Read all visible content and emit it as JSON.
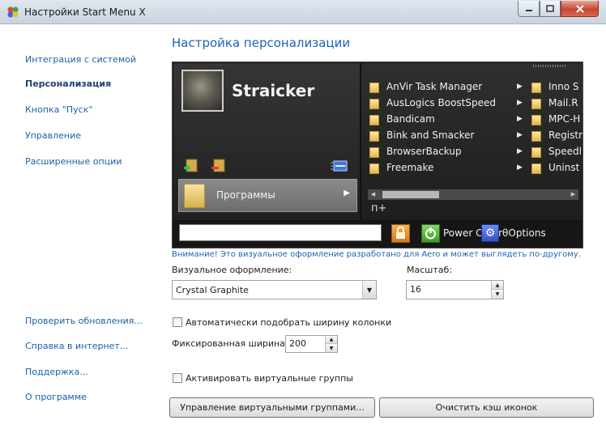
{
  "window": {
    "title": "Настройки Start Menu X"
  },
  "nav": {
    "items": [
      {
        "label": "Интеграция с системой",
        "active": false
      },
      {
        "label": "Персонализация",
        "active": true
      },
      {
        "label": "Кнопка \"Пуск\"",
        "active": false
      },
      {
        "label": "Управление",
        "active": false
      },
      {
        "label": "Расширенные опции",
        "active": false
      }
    ],
    "bottom_items": [
      {
        "label": "Проверить обновления..."
      },
      {
        "label": "Справка в интернет..."
      },
      {
        "label": "Поддержка..."
      },
      {
        "label": "О программе"
      }
    ]
  },
  "main": {
    "heading": "Настройка персонализации",
    "preview": {
      "user_name": "Straicker",
      "programs_label": "Программы",
      "menu_items": [
        "AnVir Task Manager",
        "AusLogics BoostSpeed",
        "Bandicam",
        "Bink and Smacker",
        "BrowserBackup",
        "Freemake"
      ],
      "menu_col2": [
        "Inno S",
        "Mail.R",
        "MPC-H",
        "Registr",
        "Speedl",
        "Uninst"
      ],
      "resize_mark": "п+",
      "power_label": "Power ContrθOptions"
    },
    "warning": "Внимание! Это визуальное оформление разработано для Aero и может выглядеть по-другому.",
    "theme_label": "Визуальное оформление:",
    "theme_value": "Crystal Graphite",
    "scale_label": "Масштаб:",
    "scale_value": "16",
    "auto_width_label": "Автоматически подобрать ширину колонки",
    "auto_width_checked": false,
    "fixed_width_label": "Фиксированная ширина:",
    "fixed_width_value": "200",
    "virtual_groups_label": "Активировать виртуальные группы",
    "virtual_groups_checked": false,
    "manage_groups_button": "Управление виртуальными группами...",
    "clear_cache_button": "Очистить кэш иконок"
  },
  "colors": {
    "accent": "#1c63b7",
    "preview_bg": "#111111"
  }
}
